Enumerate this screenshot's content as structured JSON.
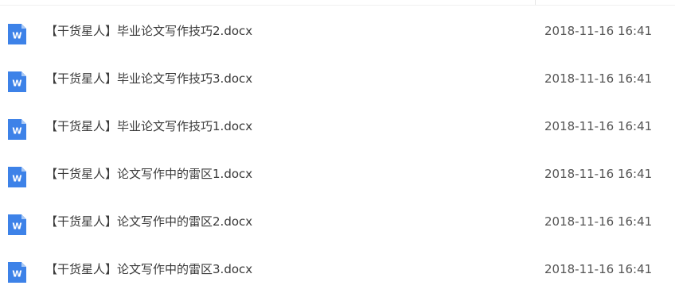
{
  "files": [
    {
      "name": "【干货星人】毕业论文写作技巧2.docx",
      "modified": "2018-11-16 16:41",
      "icon": "word-doc-icon"
    },
    {
      "name": "【干货星人】毕业论文写作技巧3.docx",
      "modified": "2018-11-16 16:41",
      "icon": "word-doc-icon"
    },
    {
      "name": "【干货星人】毕业论文写作技巧1.docx",
      "modified": "2018-11-16 16:41",
      "icon": "word-doc-icon"
    },
    {
      "name": "【干货星人】论文写作中的雷区1.docx",
      "modified": "2018-11-16 16:41",
      "icon": "word-doc-icon"
    },
    {
      "name": "【干货星人】论文写作中的雷区2.docx",
      "modified": "2018-11-16 16:41",
      "icon": "word-doc-icon"
    },
    {
      "name": "【干货星人】论文写作中的雷区3.docx",
      "modified": "2018-11-16 16:41",
      "icon": "word-doc-icon"
    }
  ],
  "icon_letter": "W",
  "colors": {
    "word_icon_blue": "#3d82e8",
    "word_icon_fold": "#a9c9f5",
    "text": "#3a3a3a",
    "date_text": "#555555"
  }
}
